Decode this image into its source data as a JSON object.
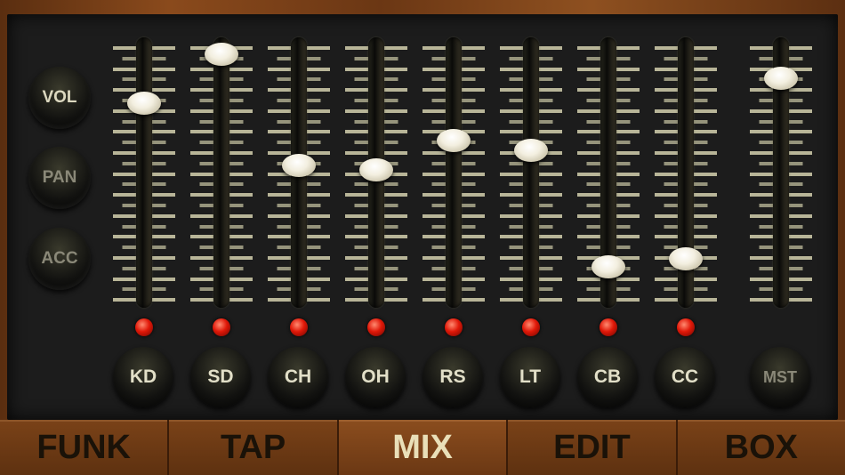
{
  "side_buttons": [
    {
      "label": "VOL",
      "active": true
    },
    {
      "label": "PAN",
      "active": false
    },
    {
      "label": "ACC",
      "active": false
    }
  ],
  "channels": [
    {
      "label": "KD",
      "level": 0.78,
      "led": true
    },
    {
      "label": "SD",
      "level": 0.98,
      "led": true
    },
    {
      "label": "CH",
      "level": 0.53,
      "led": true
    },
    {
      "label": "OH",
      "level": 0.51,
      "led": true
    },
    {
      "label": "RS",
      "level": 0.63,
      "led": true
    },
    {
      "label": "LT",
      "level": 0.59,
      "led": true
    },
    {
      "label": "CB",
      "level": 0.12,
      "led": true
    },
    {
      "label": "CC",
      "level": 0.15,
      "led": true
    }
  ],
  "master": {
    "label": "MST",
    "level": 0.88
  },
  "tabs": [
    {
      "label": "FUNK",
      "active": false
    },
    {
      "label": "TAP",
      "active": false
    },
    {
      "label": "MIX",
      "active": true
    },
    {
      "label": "EDIT",
      "active": false
    },
    {
      "label": "BOX",
      "active": false
    }
  ]
}
